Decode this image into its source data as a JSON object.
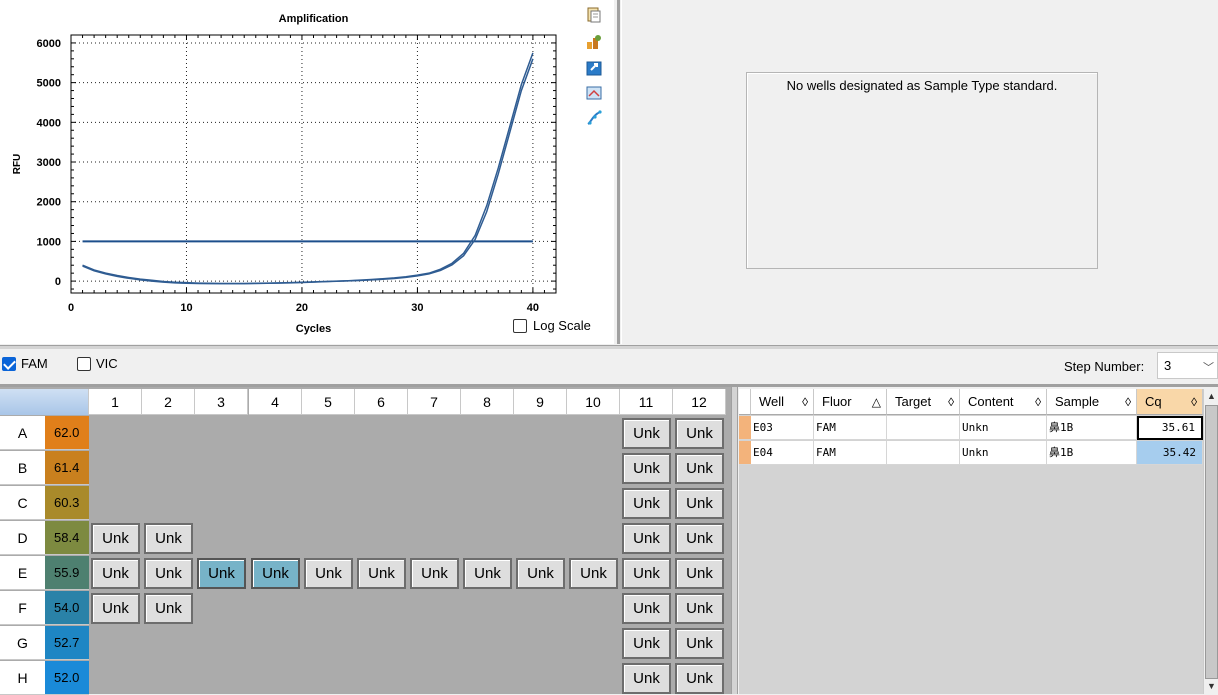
{
  "chart_data": {
    "type": "line",
    "title": "Amplification",
    "xlabel": "Cycles",
    "ylabel": "RFU",
    "xlim": [
      0,
      42
    ],
    "ylim": [
      -300,
      6200
    ],
    "xticks": [
      0,
      10,
      20,
      30,
      40
    ],
    "yticks": [
      0,
      1000,
      2000,
      3000,
      4000,
      5000,
      6000
    ],
    "grid": true,
    "threshold": 1000,
    "series": [
      {
        "x": [
          1,
          2,
          3,
          4,
          5,
          6,
          7,
          8,
          9,
          10,
          11,
          12,
          13,
          14,
          15,
          16,
          17,
          18,
          19,
          20,
          21,
          22,
          23,
          24,
          25,
          26,
          27,
          28,
          29,
          30,
          31,
          32,
          33,
          34,
          35,
          36,
          37,
          38,
          39,
          40
        ],
        "values": [
          400,
          280,
          200,
          140,
          90,
          50,
          20,
          -10,
          -30,
          -40,
          -50,
          -55,
          -60,
          -60,
          -60,
          -55,
          -50,
          -45,
          -40,
          -30,
          -20,
          -10,
          0,
          10,
          25,
          40,
          60,
          80,
          110,
          150,
          200,
          300,
          450,
          700,
          1150,
          1900,
          2850,
          3900,
          4950,
          5750
        ]
      },
      {
        "x": [
          1,
          2,
          3,
          4,
          5,
          6,
          7,
          8,
          9,
          10,
          11,
          12,
          13,
          14,
          15,
          16,
          17,
          18,
          19,
          20,
          21,
          22,
          23,
          24,
          25,
          26,
          27,
          28,
          29,
          30,
          31,
          32,
          33,
          34,
          35,
          36,
          37,
          38,
          39,
          40
        ],
        "values": [
          380,
          260,
          180,
          120,
          70,
          30,
          0,
          -25,
          -45,
          -55,
          -60,
          -65,
          -65,
          -65,
          -65,
          -60,
          -55,
          -50,
          -45,
          -35,
          -25,
          -15,
          -5,
          5,
          15,
          30,
          45,
          65,
          95,
          130,
          180,
          270,
          410,
          640,
          1050,
          1750,
          2700,
          3750,
          4800,
          5600
        ]
      }
    ],
    "colors": [
      "#2f5c92",
      "#2f5c92"
    ]
  },
  "log_scale": {
    "label": "Log Scale",
    "checked": false
  },
  "standard_curve": {
    "message": "No wells designated as Sample Type standard."
  },
  "fluors": [
    {
      "label": "FAM",
      "checked": true
    },
    {
      "label": "VIC",
      "checked": false
    }
  ],
  "step": {
    "label": "Step Number:",
    "value": "3"
  },
  "plate": {
    "columns": [
      "1",
      "2",
      "3",
      "4",
      "5",
      "6",
      "7",
      "8",
      "9",
      "10",
      "11",
      "12"
    ],
    "rows": [
      {
        "label": "A",
        "temp": "62.0",
        "color": "#e07f1a",
        "wells": [
          11,
          12
        ]
      },
      {
        "label": "B",
        "temp": "61.4",
        "color": "#c9801e",
        "wells": [
          11,
          12
        ]
      },
      {
        "label": "C",
        "temp": "60.3",
        "color": "#a98a2a",
        "wells": [
          11,
          12
        ]
      },
      {
        "label": "D",
        "temp": "58.4",
        "color": "#7d8a40",
        "wells": [
          1,
          2,
          11,
          12
        ]
      },
      {
        "label": "E",
        "temp": "55.9",
        "color": "#4e8070",
        "wells": [
          1,
          2,
          3,
          4,
          5,
          6,
          7,
          8,
          9,
          10,
          11,
          12
        ]
      },
      {
        "label": "F",
        "temp": "54.0",
        "color": "#2a82a8",
        "wells": [
          1,
          2,
          11,
          12
        ]
      },
      {
        "label": "G",
        "temp": "52.7",
        "color": "#1e86c4",
        "wells": [
          11,
          12
        ]
      },
      {
        "label": "H",
        "temp": "52.0",
        "color": "#1a8ad8",
        "wells": [
          11,
          12
        ]
      }
    ],
    "well_label": "Unk",
    "selected": [
      "E3",
      "E4"
    ]
  },
  "well_table": {
    "headers": [
      "Well",
      "Fluor",
      "Target",
      "Content",
      "Sample",
      "Cq"
    ],
    "sort_icons": [
      "◊",
      "△",
      "◊",
      "◊",
      "◊",
      "◊"
    ],
    "rows": [
      {
        "well": "E03",
        "fluor": "FAM",
        "target": "",
        "content": "Unkn",
        "sample": "鼻1B",
        "cq": "35.61"
      },
      {
        "well": "E04",
        "fluor": "FAM",
        "target": "",
        "content": "Unkn",
        "sample": "鼻1B",
        "cq": "35.42"
      }
    ]
  }
}
